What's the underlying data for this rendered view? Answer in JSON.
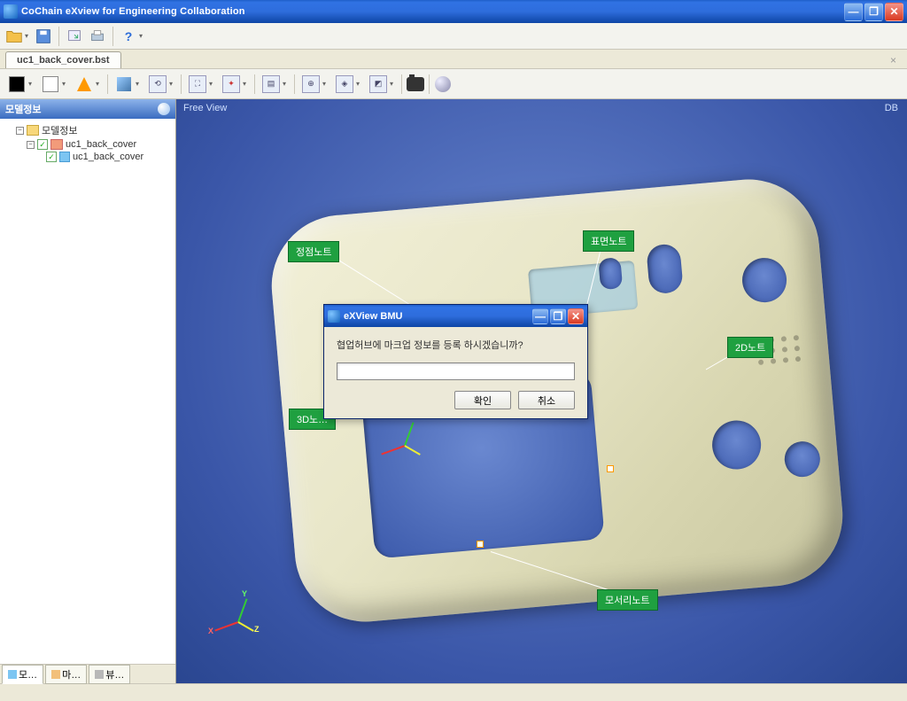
{
  "titlebar": {
    "title": "CoChain eXview for Engineering Collaboration"
  },
  "toolbar1": {
    "open_label": "Open folder",
    "save_label": "Save",
    "print_label": "Print",
    "help_label": "Help"
  },
  "tabs": {
    "doc1": "uc1_back_cover.bst"
  },
  "sidebar": {
    "panel_title": "모델정보",
    "tree": {
      "root": "모델정보",
      "n1": "uc1_back_cover",
      "n2": "uc1_back_cover"
    },
    "bottom_tabs": {
      "t1": "모…",
      "t2": "마…",
      "t3": "뷰…"
    }
  },
  "viewport": {
    "mode": "Free View",
    "db": "DB",
    "labels": {
      "vertex": "정점노트",
      "surface": "표면노트",
      "note2d": "2D노트",
      "note3d": "3D노…",
      "edge": "모서리노트"
    },
    "axes": {
      "x": "X",
      "y": "Y",
      "z": "Z"
    }
  },
  "dialog": {
    "title": "eXView BMU",
    "message": "협업허브에 마크업 정보를 등록 하시겠습니까?",
    "ok": "확인",
    "cancel": "취소"
  }
}
